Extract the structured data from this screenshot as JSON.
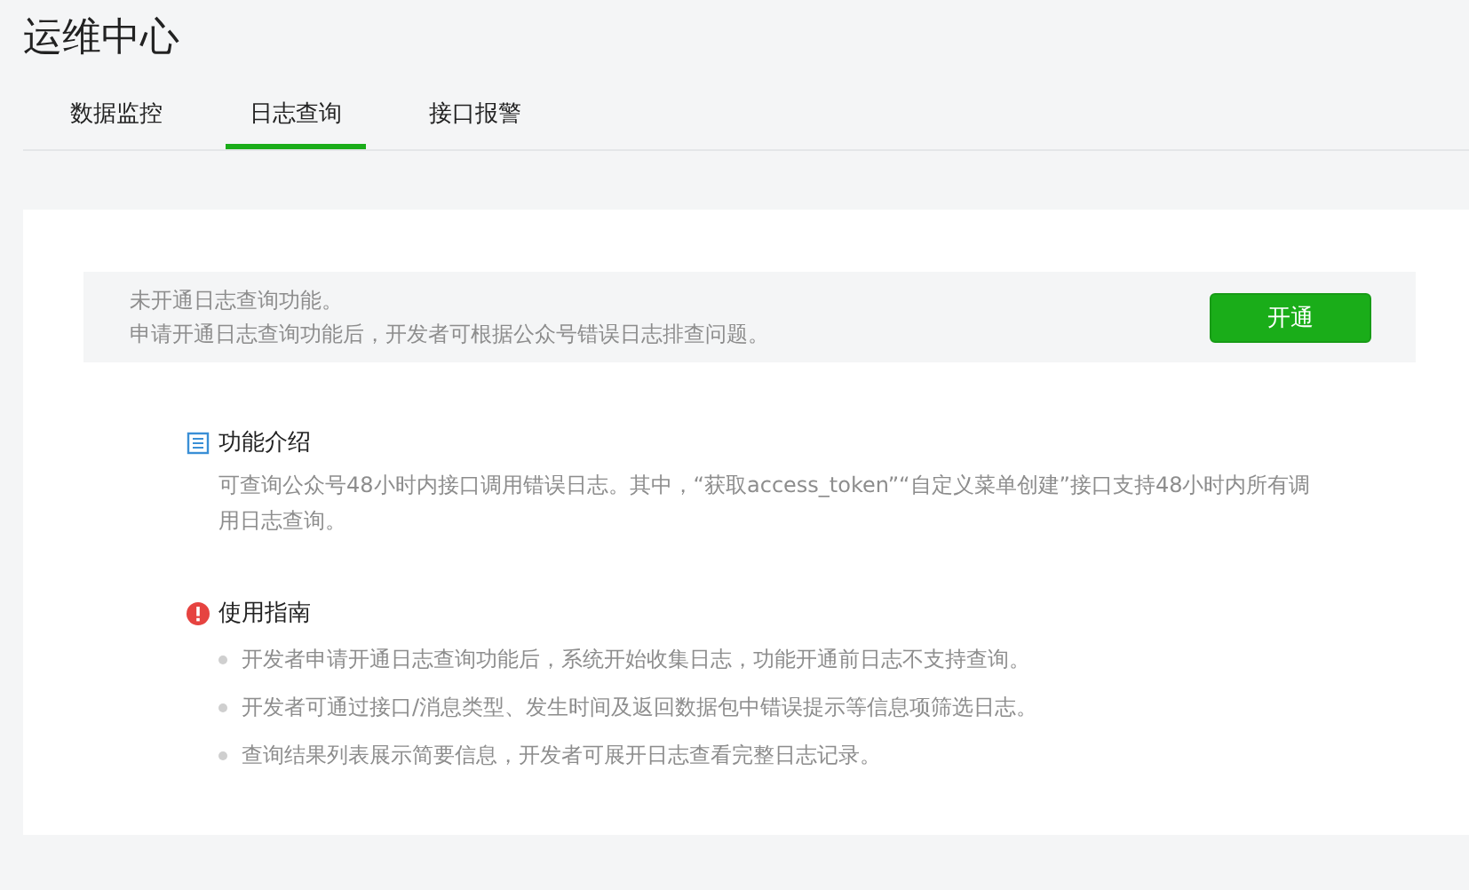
{
  "page_title": "运维中心",
  "tabs": [
    {
      "label": "数据监控",
      "selected": false
    },
    {
      "label": "日志查询",
      "selected": true
    },
    {
      "label": "接口报警",
      "selected": false
    }
  ],
  "notice": {
    "lines": [
      "未开通日志查询功能。",
      "申请开通日志查询功能后，开发者可根据公众号错误日志排查问题。"
    ],
    "button": "开通"
  },
  "sections": [
    {
      "kind": "intro",
      "title": "功能介绍",
      "text": "可查询公众号48小时内接口调用错误日志。其中，“获取access_token”“自定义菜单创建”接口支持48小时内所有调用日志查询。"
    },
    {
      "kind": "guide",
      "title": "使用指南",
      "items": [
        "开发者申请开通日志查询功能后，系统开始收集日志，功能开通前日志不支持查询。",
        "开发者可通过接口/消息类型、发生时间及返回数据包中错误提示等信息项筛选日志。",
        "查询结果列表展示简要信息，开发者可展开日志查看完整日志记录。"
      ]
    }
  ]
}
